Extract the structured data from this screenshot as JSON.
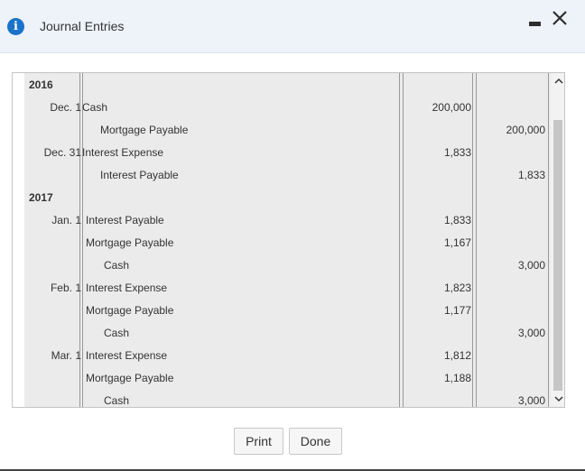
{
  "dialog": {
    "title": "Journal Entries",
    "info_icon": "i"
  },
  "journal": {
    "rows": [
      {
        "year": "2016"
      },
      {
        "date": "Dec. 1",
        "account": "Cash",
        "debit": "200,000"
      },
      {
        "account": "Mortgage Payable",
        "credit": "200,000",
        "indent": true
      },
      {
        "date": "Dec. 31",
        "account": "Interest Expense",
        "debit": "1,833"
      },
      {
        "account": "Interest Payable",
        "credit": "1,833",
        "indent": true
      },
      {
        "year": "2017"
      },
      {
        "date": "Jan. 1",
        "account": "Interest Payable",
        "debit": "1,833"
      },
      {
        "account": "Mortgage Payable",
        "debit": "1,167"
      },
      {
        "account": "Cash",
        "credit": "3,000",
        "indent": true
      },
      {
        "date": "Feb. 1",
        "account": "Interest Expense",
        "debit": "1,823"
      },
      {
        "account": "Mortgage Payable",
        "debit": "1,177"
      },
      {
        "account": "Cash",
        "credit": "3,000",
        "indent": true
      },
      {
        "date": "Mar. 1",
        "account": "Interest Expense",
        "debit": "1,812"
      },
      {
        "account": "Mortgage Payable",
        "debit": "1,188"
      },
      {
        "account": "Cash",
        "credit": "3,000",
        "indent": true
      }
    ]
  },
  "buttons": {
    "print": "Print",
    "done": "Done"
  },
  "icons": {
    "info": "info-icon",
    "minimize": "minimize-icon",
    "close": "close-icon",
    "scroll_up": "scroll-up-arrow-icon",
    "scroll_down": "scroll-down-arrow-icon"
  },
  "colors": {
    "accent": "#1a73c9",
    "title_bar": "#eef3fa",
    "table_bg": "#ebebeb"
  }
}
